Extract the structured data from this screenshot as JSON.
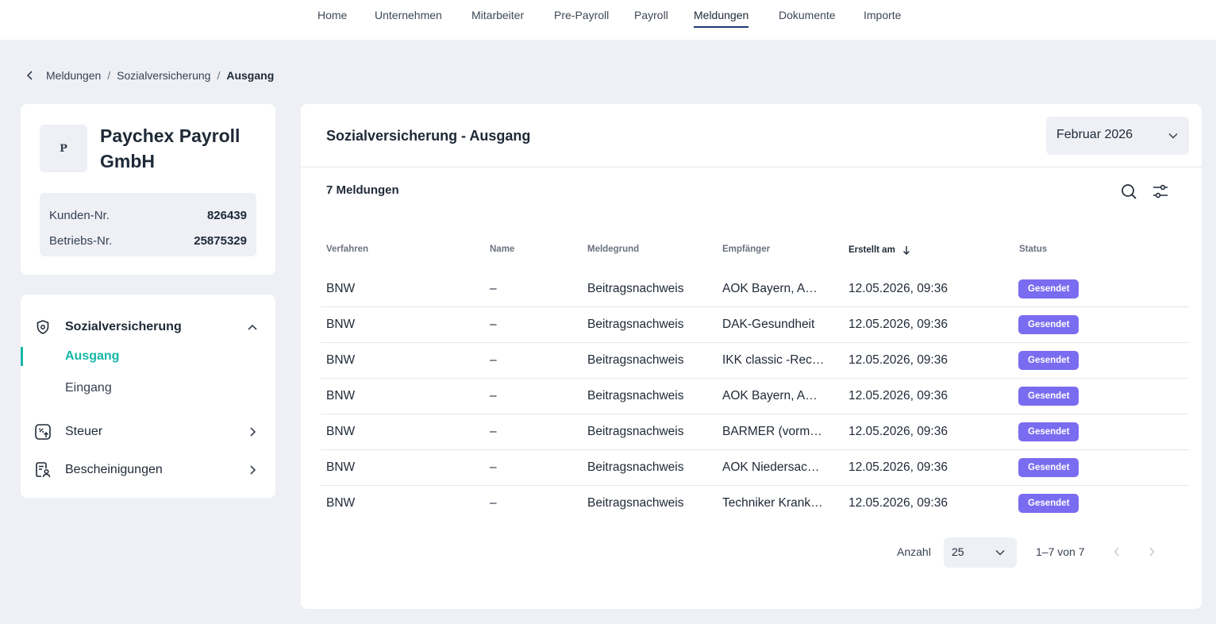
{
  "nav": {
    "items": [
      "Home",
      "Unternehmen",
      "Mitarbeiter",
      "Pre-Payroll",
      "Payroll",
      "Meldungen",
      "Dokumente",
      "Importe"
    ],
    "active": "Meldungen"
  },
  "breadcrumb": {
    "items": [
      "Meldungen",
      "Sozialversicherung",
      "Ausgang"
    ],
    "separator": "/"
  },
  "company": {
    "avatar_letter": "P",
    "name": "Paychex Payroll GmbH",
    "kunden_label": "Kunden-Nr.",
    "kunden_value": "826439",
    "betriebs_label": "Betriebs-Nr.",
    "betriebs_value": "25875329"
  },
  "side_menu": {
    "group1": {
      "label": "Sozialversicherung",
      "icon": "shield-icon",
      "expanded": true
    },
    "sub_active": "Ausgang",
    "sub_other": "Eingang",
    "group2": {
      "label": "Steuer",
      "icon": "tax-percent-icon"
    },
    "group3": {
      "label": "Bescheinigungen",
      "icon": "certificate-icon"
    }
  },
  "panel": {
    "title": "Sozialversicherung - Ausgang",
    "month": "Februar 2026",
    "count_label": "7 Meldungen"
  },
  "table": {
    "headers": {
      "verfahren": "Verfahren",
      "name": "Name",
      "meldegrund": "Meldegrund",
      "empfaenger": "Empfänger",
      "erstellt": "Erstellt am",
      "status": "Status"
    },
    "rows": [
      {
        "verfahren": "BNW",
        "name": "–",
        "meldegrund": "Beitragsnachweis",
        "empfaenger": "AOK Bayern, AO…",
        "erstellt": "12.05.2026, 09:36",
        "status": "Gesendet"
      },
      {
        "verfahren": "BNW",
        "name": "–",
        "meldegrund": "Beitragsnachweis",
        "empfaenger": "DAK-Gesundheit",
        "erstellt": "12.05.2026, 09:36",
        "status": "Gesendet"
      },
      {
        "verfahren": "BNW",
        "name": "–",
        "meldegrund": "Beitragsnachweis",
        "empfaenger": "IKK classic -Rec…",
        "erstellt": "12.05.2026, 09:36",
        "status": "Gesendet"
      },
      {
        "verfahren": "BNW",
        "name": "–",
        "meldegrund": "Beitragsnachweis",
        "empfaenger": "AOK Bayern, AO…",
        "erstellt": "12.05.2026, 09:36",
        "status": "Gesendet"
      },
      {
        "verfahren": "BNW",
        "name": "–",
        "meldegrund": "Beitragsnachweis",
        "empfaenger": "BARMER (vorm…",
        "erstellt": "12.05.2026, 09:36",
        "status": "Gesendet"
      },
      {
        "verfahren": "BNW",
        "name": "–",
        "meldegrund": "Beitragsnachweis",
        "empfaenger": "AOK Niedersach…",
        "erstellt": "12.05.2026, 09:36",
        "status": "Gesendet"
      },
      {
        "verfahren": "BNW",
        "name": "–",
        "meldegrund": "Beitragsnachweis",
        "empfaenger": "Techniker Krank…",
        "erstellt": "12.05.2026, 09:36",
        "status": "Gesendet"
      }
    ]
  },
  "pagination": {
    "label": "Anzahl",
    "page_size": "25",
    "range": "1–7 von 7"
  },
  "colors": {
    "accent": "#14b8a6",
    "badge": "#7a6cf0",
    "background": "#eef0f6"
  }
}
